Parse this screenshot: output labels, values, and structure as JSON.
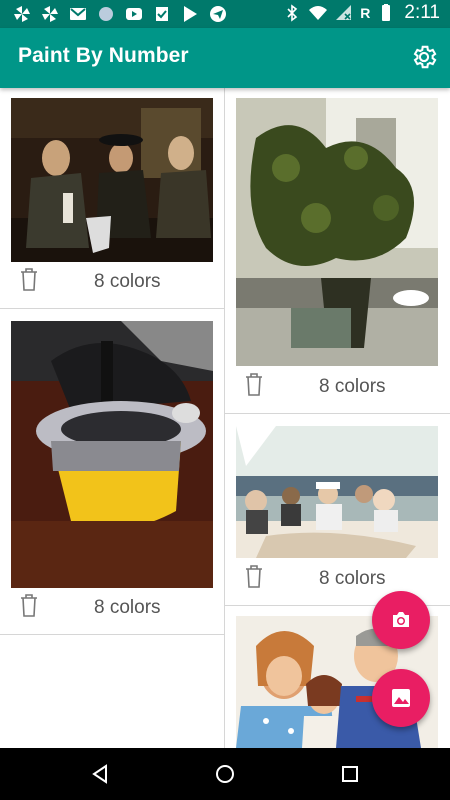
{
  "status_bar": {
    "time": "2:11",
    "roaming_label": "R",
    "colors": {
      "background": "#00796b"
    }
  },
  "app_bar": {
    "title": "Paint By Number",
    "settings_icon": "gear-icon",
    "colors": {
      "background": "#009688"
    }
  },
  "artworks": [
    {
      "colors_label": "8 colors",
      "image": "group portrait of three men in dark coats"
    },
    {
      "colors_label": "8 colors",
      "image": "potted plant by a window"
    },
    {
      "colors_label": "8 colors",
      "image": "close-up of a yellow cup with metal strainer"
    },
    {
      "colors_label": "8 colors",
      "image": "people on a boat on the water"
    },
    {
      "colors_label": "",
      "image": "family of three smiling"
    }
  ],
  "fab_camera": {
    "icon": "camera-icon",
    "color": "#e91e63"
  },
  "fab_gallery": {
    "icon": "image-icon",
    "color": "#e91e63"
  },
  "nav_bar": {
    "back_icon": "back-icon",
    "home_icon": "home-icon",
    "recents_icon": "recents-icon"
  }
}
